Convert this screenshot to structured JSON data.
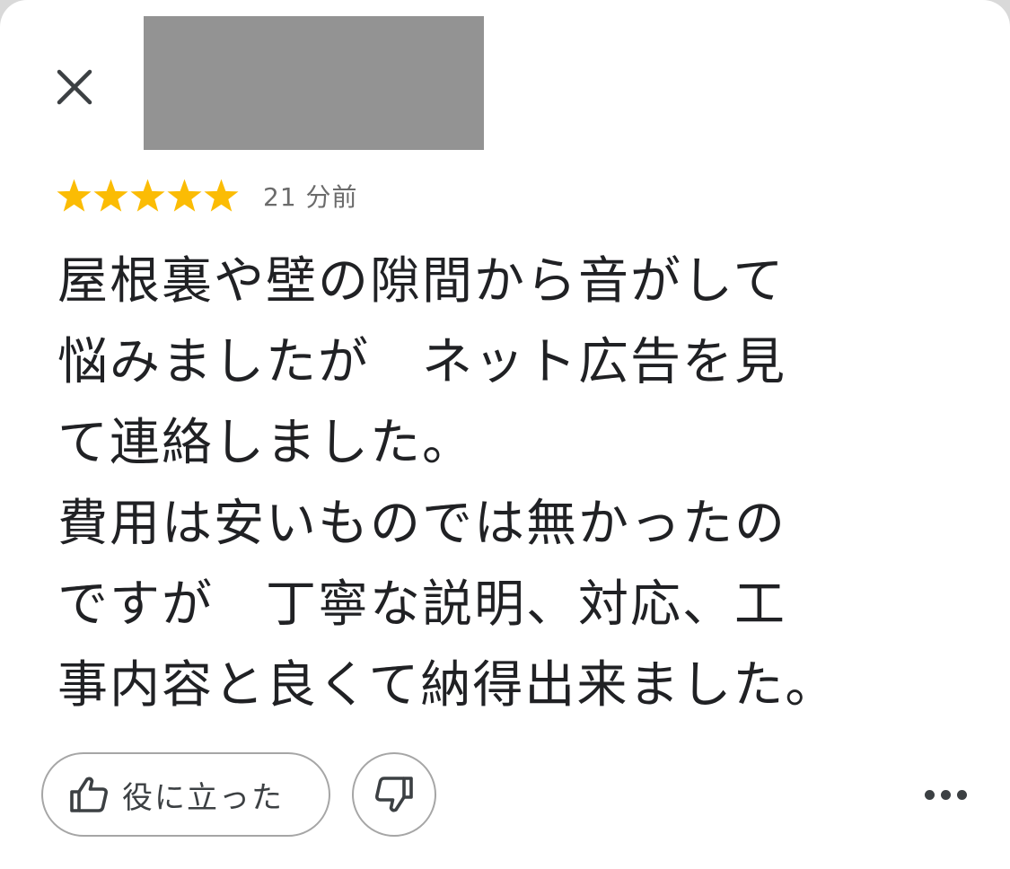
{
  "review": {
    "rating": 5,
    "max_rating": 5,
    "star_color": "#fbbc04",
    "timestamp": "21 分前",
    "text": "屋根裏や壁の隙間から音がして\n悩みましたが　ネット広告を見\nて連絡しました。\n費用は安いものでは無かったの\nですが　丁寧な説明、対応、工\n事内容と良くて納得出来ました。"
  },
  "actions": {
    "helpful_label": "役に立った",
    "helpful_icon": "thumbs-up-icon",
    "not_helpful_icon": "thumbs-down-icon",
    "more_icon": "more-horizontal-icon",
    "close_icon": "close-icon"
  },
  "colors": {
    "text": "#202124",
    "muted": "#6b6b6b",
    "border": "#a6a6a6",
    "redaction": "#939393"
  }
}
